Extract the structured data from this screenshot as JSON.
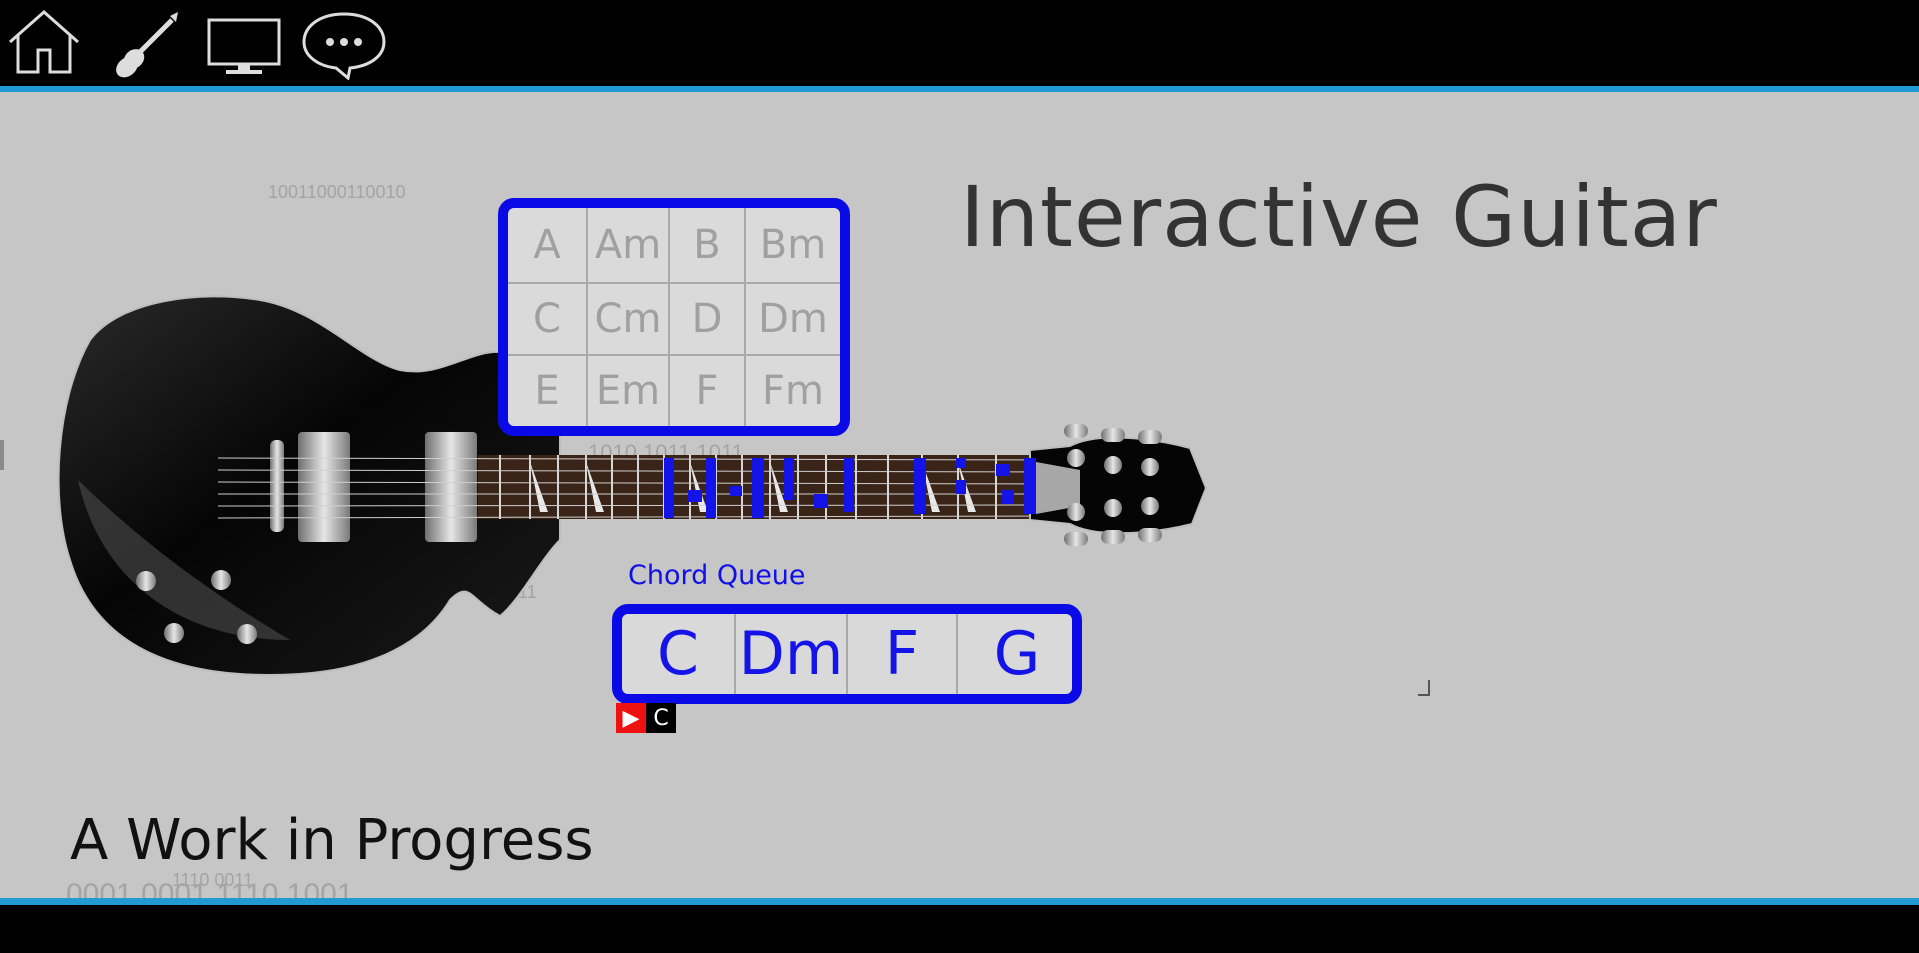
{
  "nav": {
    "items": [
      {
        "icon": "home-icon"
      },
      {
        "icon": "guitar-icon"
      },
      {
        "icon": "monitor-icon"
      },
      {
        "icon": "chat-icon"
      }
    ]
  },
  "background_binary": {
    "top": "10011000110010",
    "neck": "1010 1011 1011",
    "body": "011",
    "bottom_small": "1110 0011",
    "bottom_large": "0001 0001 1110 1001"
  },
  "title": "Interactive Guitar",
  "subtitle": "A Work in Progress",
  "chord_picker": {
    "chords": [
      "A",
      "Am",
      "B",
      "Bm",
      "C",
      "Cm",
      "D",
      "Dm",
      "E",
      "Em",
      "F",
      "Fm"
    ]
  },
  "chord_queue": {
    "label": "Chord Queue",
    "items": [
      "C",
      "Dm",
      "F",
      "G"
    ]
  },
  "player": {
    "play_symbol": "▶",
    "current_chord": "C"
  },
  "colors": {
    "accent_blue": "#0a0ae6",
    "bar_line": "#1f9bd1",
    "play_red": "#ee1111"
  }
}
